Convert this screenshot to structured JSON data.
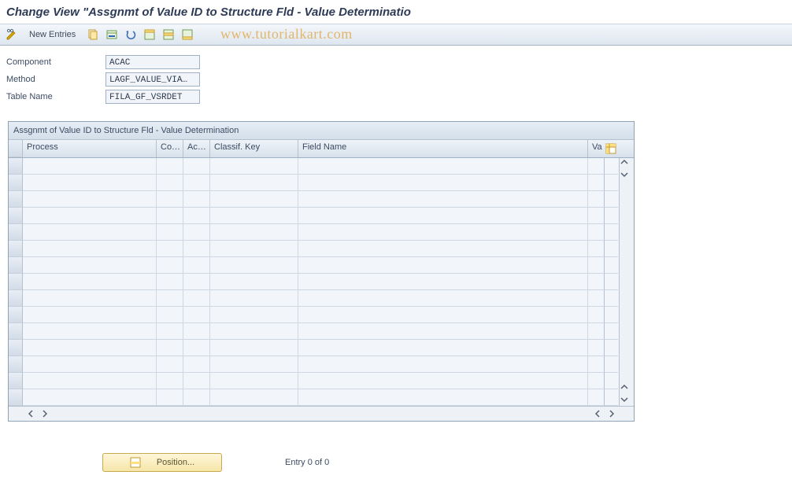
{
  "title": "Change View \"Assgnmt of Value ID to Structure Fld - Value Determinatio",
  "watermark": "www.tutorialkart.com",
  "toolbar": {
    "new_entries_label": "New Entries"
  },
  "form": {
    "component": {
      "label": "Component",
      "value": "ACAC"
    },
    "method": {
      "label": "Method",
      "value": "LAGF_VALUE_VIA…"
    },
    "table": {
      "label": "Table Name",
      "value": "FILA_GF_VSRDET"
    }
  },
  "grid": {
    "title": "Assgnmt of Value ID to Structure Fld - Value Determination",
    "columns": {
      "process": "Process",
      "co": "Co…",
      "ac": "Ac…",
      "classif": "Classif. Key",
      "field": "Field Name",
      "val": "Va"
    },
    "rows": [
      {},
      {},
      {},
      {},
      {},
      {},
      {},
      {},
      {},
      {},
      {},
      {},
      {},
      {},
      {}
    ]
  },
  "footer": {
    "position_label": "Position...",
    "entry_text": "Entry 0 of 0"
  }
}
